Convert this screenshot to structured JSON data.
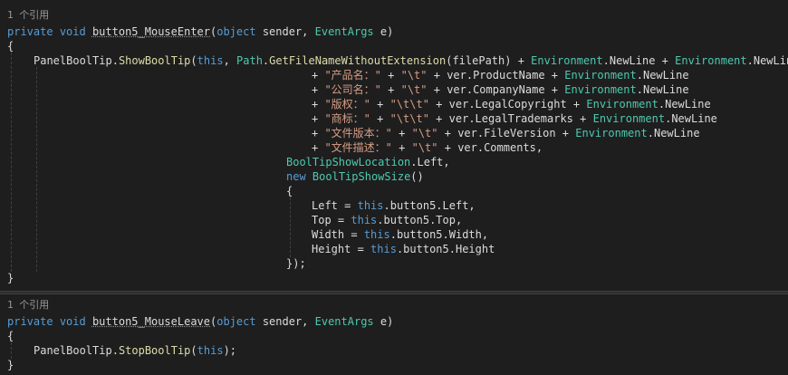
{
  "blocks": [
    {
      "codelens": "1 个引用",
      "sig": {
        "access": "private",
        "ret": "void",
        "name": "button5_MouseEnter",
        "p1type": "object",
        "p1name": " sender, ",
        "p2type": "EventArgs",
        "p2name": " e)"
      },
      "open_brace": "{",
      "close_brace": "}",
      "call": {
        "obj": "PanelBoolTip",
        "method": "ShowBoolTip",
        "this_kw": "this",
        "path_type": "Path",
        "path_method": "GetFileNameWithoutExtension",
        "path_arg": "(filePath) + ",
        "env": "Environment",
        "nl": "NewLine"
      },
      "concat_lines": [
        {
          "str1": "\"产品名：\"",
          "str2": "\"\\t\"",
          "prop": "ver.ProductName",
          "nl_count": 1
        },
        {
          "str1": "\"公司名：\"",
          "str2": "\"\\t\"",
          "prop": "ver.CompanyName",
          "nl_count": 1
        },
        {
          "str1": "\"版权：\"",
          "str2": "\"\\t\\t\"",
          "prop": "ver.LegalCopyright",
          "nl_count": 1
        },
        {
          "str1": "\"商标：\"",
          "str2": "\"\\t\\t\"",
          "prop": "ver.LegalTrademarks",
          "nl_count": 1
        },
        {
          "str1": "\"文件版本：\"",
          "str2": "\"\\t\"",
          "prop": "ver.FileVersion",
          "nl_count": 1
        },
        {
          "str1": "\"文件描述：\"",
          "str2": "\"\\t\"",
          "prop": "ver.Comments,",
          "nl_count": 0
        }
      ],
      "location": {
        "type": "BoolTipShowLocation",
        "rest": ".Left,"
      },
      "size": {
        "new_kw": "new",
        "type": "BoolTipShowSize",
        "rest": "()",
        "open": "{",
        "close": "});"
      },
      "assignments": [
        {
          "name": "Left",
          "prop": ".button5.Left,"
        },
        {
          "name": "Top",
          "prop": ".button5.Top,"
        },
        {
          "name": "Width",
          "prop": ".button5.Width,"
        },
        {
          "name": "Height",
          "prop": ".button5.Height"
        }
      ]
    },
    {
      "codelens": "1 个引用",
      "sig": {
        "access": "private",
        "ret": "void",
        "name": "button5_MouseLeave",
        "p1type": "object",
        "p1name": " sender, ",
        "p2type": "EventArgs",
        "p2name": " e)"
      },
      "open_brace": "{",
      "close_brace": "}",
      "call": {
        "obj": "PanelBoolTip",
        "method": "StopBoolTip",
        "this_kw": "this",
        "rest": ");"
      }
    }
  ],
  "colors": {
    "background": "#1e1e1e",
    "keyword": "#569cd6",
    "type": "#4ec9b0",
    "string": "#d69d85",
    "method": "#dcdcaa",
    "text": "#dcdcdc",
    "codelens": "#999999"
  }
}
